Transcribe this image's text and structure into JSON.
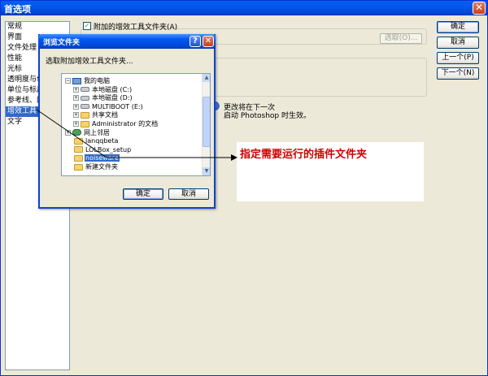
{
  "window": {
    "title": "首选项",
    "close_glyph": "✕"
  },
  "categories": [
    {
      "label": "常规",
      "selected": false
    },
    {
      "label": "界面",
      "selected": false
    },
    {
      "label": "文件处理",
      "selected": false
    },
    {
      "label": "性能",
      "selected": false
    },
    {
      "label": "光标",
      "selected": false
    },
    {
      "label": "透明度与色",
      "selected": false
    },
    {
      "label": "单位与标尺",
      "selected": false
    },
    {
      "label": "参考线、网",
      "selected": false
    },
    {
      "label": "增效工具",
      "selected": true
    },
    {
      "label": "文字",
      "selected": false
    }
  ],
  "buttons": {
    "ok": "确定",
    "cancel": "取消",
    "prev": "上一个(P)",
    "next": "下一个(N)"
  },
  "plugins": {
    "additional_folder_label": "附加的增效工具文件夹(A)",
    "additional_folder_checked": true,
    "check_glyph": "✓",
    "choose_button": "选取(O)...",
    "restart_note_line1": "更改将在下一次",
    "restart_note_line2": "启动 Photoshop 时生效。",
    "info_glyph": "i"
  },
  "browse": {
    "title": "浏览文件夹",
    "help_glyph": "?",
    "close_glyph": "✕",
    "prompt": "选取附加增效工具文件夹...",
    "ok": "确定",
    "cancel": "取消",
    "scroll_up_glyph": "▲",
    "scroll_down_glyph": "▼",
    "tree": [
      {
        "label": "我的电脑",
        "icon": "computer-icon",
        "expander": "−",
        "depth": 0
      },
      {
        "label": "本地磁盘 (C:)",
        "icon": "drive-icon",
        "expander": "+",
        "depth": 1
      },
      {
        "label": "本地磁盘 (D:)",
        "icon": "drive-icon",
        "expander": "+",
        "depth": 1
      },
      {
        "label": "MULTIBOOT (E:)",
        "icon": "drive-icon",
        "expander": "+",
        "depth": 1
      },
      {
        "label": "共享文档",
        "icon": "folder-icon",
        "expander": "+",
        "depth": 1
      },
      {
        "label": "Administrator 的文档",
        "icon": "folder-icon",
        "expander": "+",
        "depth": 1
      },
      {
        "label": "网上邻居",
        "icon": "network-icon",
        "expander": "+",
        "depth": 0
      },
      {
        "label": "lanqqbeta",
        "icon": "folder-icon",
        "expander": "",
        "depth": 0
      },
      {
        "label": "LOLBox_setup",
        "icon": "folder-icon",
        "expander": "",
        "depth": 0
      },
      {
        "label": "noiseware",
        "icon": "folder-icon",
        "expander": "",
        "depth": 0,
        "selected": true
      },
      {
        "label": "新建文件夹",
        "icon": "folder-icon",
        "expander": "",
        "depth": 0
      }
    ]
  },
  "annotation": {
    "text": "指定需要运行的插件文件夹",
    "color": "#d00000"
  }
}
